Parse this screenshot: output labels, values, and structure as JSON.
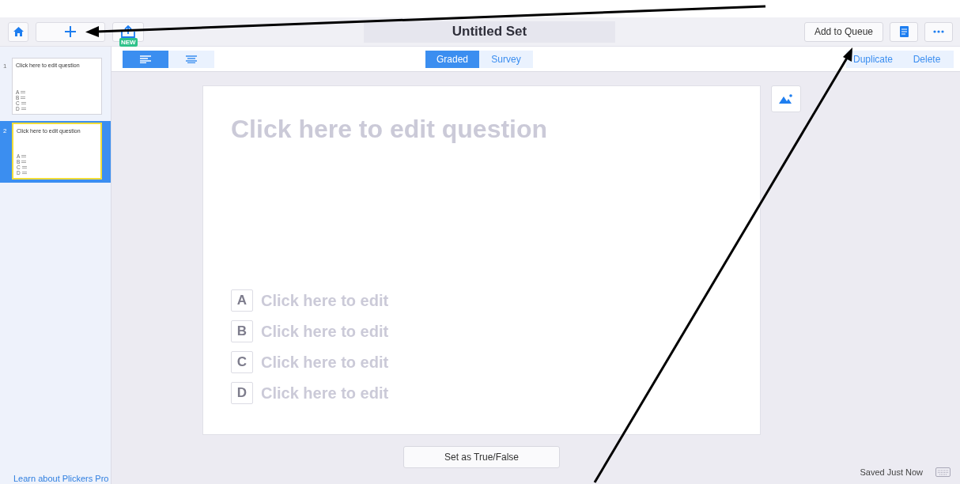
{
  "top_bar": {
    "title": "Untitled Set",
    "new_badge": "NEW",
    "queue_button": "Add to Queue"
  },
  "slides": [
    {
      "number": "1",
      "question": "Click here to edit question",
      "choices": [
        "A",
        "B",
        "C",
        "D"
      ],
      "selected": false
    },
    {
      "number": "2",
      "question": "Click here to edit question",
      "choices": [
        "A",
        "B",
        "C",
        "D"
      ],
      "selected": true
    }
  ],
  "sidebar_link": "Learn about Plickers Pro",
  "layout_toggle": [
    {
      "selected": true
    },
    {
      "selected": false
    }
  ],
  "mode_tabs": [
    {
      "label": "Graded",
      "selected": true
    },
    {
      "label": "Survey",
      "selected": false
    }
  ],
  "actions": [
    "Duplicate",
    "Delete"
  ],
  "question": {
    "placeholder": "Click here to edit question",
    "choices": [
      {
        "letter": "A",
        "placeholder": "Click here to edit"
      },
      {
        "letter": "B",
        "placeholder": "Click here to edit"
      },
      {
        "letter": "C",
        "placeholder": "Click here to edit"
      },
      {
        "letter": "D",
        "placeholder": "Click here to edit"
      }
    ]
  },
  "true_false_button": "Set as True/False",
  "status": "Saved Just Now"
}
